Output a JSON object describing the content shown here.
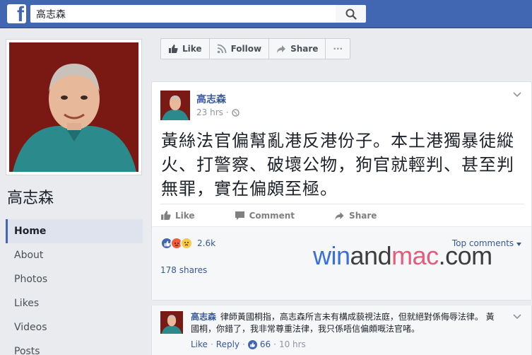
{
  "header": {
    "logo_glyph": "f",
    "search_value": "高志森"
  },
  "profile": {
    "page_name": "高志森"
  },
  "nav": {
    "items": [
      {
        "label": "Home",
        "active": true
      },
      {
        "label": "About"
      },
      {
        "label": "Photos"
      },
      {
        "label": "Likes"
      },
      {
        "label": "Videos"
      },
      {
        "label": "Posts"
      }
    ]
  },
  "page_actions": {
    "like": "Like",
    "follow": "Follow",
    "share": "Share",
    "more": "···"
  },
  "post": {
    "author": "高志森",
    "time": "23 hrs",
    "separator": "·",
    "text": "黃絲法官偏幫亂港反港份子。本土港獨暴徒縱火、打警察、破壞公物，狗官就輕判、甚至判無罪，實在偏頗至極。",
    "actions": {
      "like": "Like",
      "comment": "Comment",
      "share": "Share"
    },
    "reaction_count": "2.6k",
    "top_comments": "Top comments",
    "shares": "178 shares"
  },
  "watermark": {
    "part1": "win",
    "part2": "and",
    "part3": "mac",
    "part4": ".com"
  },
  "comment": {
    "author": "高志森",
    "text": "律師黃國桐指，高志森所言未有構成藐視法庭，但就絕對係侮辱法律。 黃國桐，你錯了，我非常尊重法律，我只係唔信偏頗嘅法官啫。",
    "like": "Like",
    "reply": "Reply",
    "likes_count": "66",
    "time": "10 hrs",
    "dot": "·"
  },
  "colors": {
    "brand": "#4267b2",
    "link": "#365899",
    "page_bg": "#e9ebee"
  }
}
